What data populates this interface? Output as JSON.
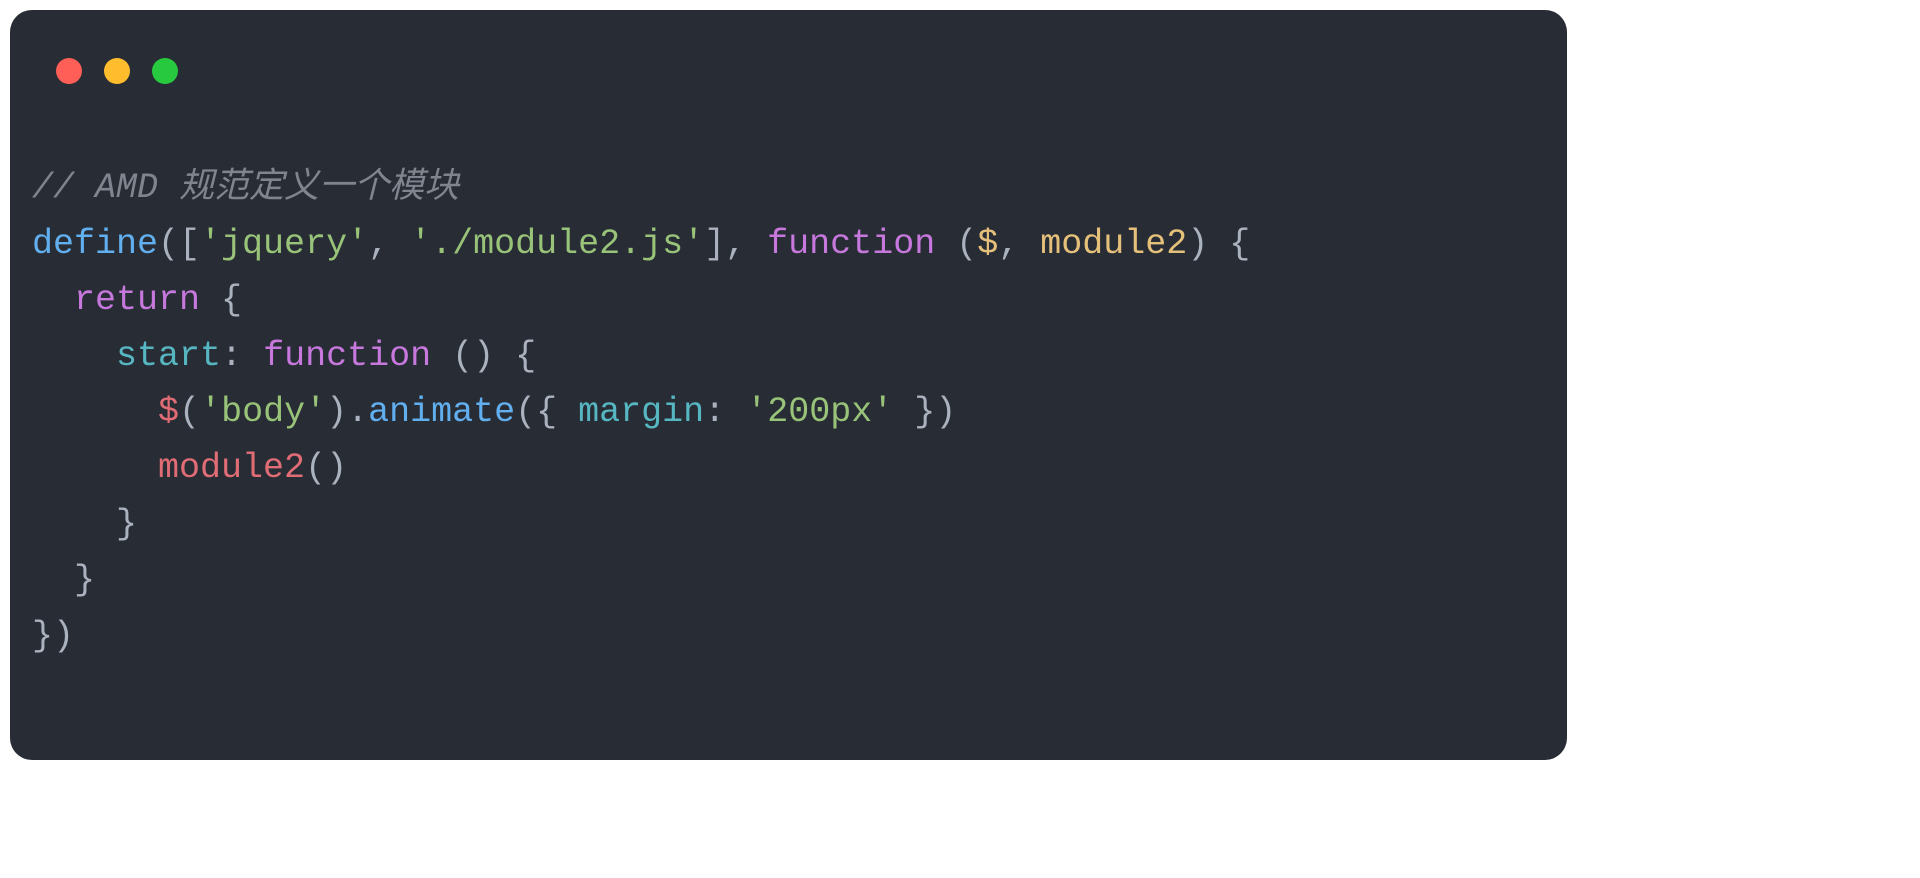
{
  "traffic": {
    "red": "#ff5f56",
    "yellow": "#ffbd2e",
    "green": "#27c93f"
  },
  "code": {
    "l1_comment": "// AMD 规范定义一个模块",
    "l2_define": "define",
    "l2_ob": "([",
    "l2_s1": "'jquery'",
    "l2_comma1": ", ",
    "l2_s2": "'./module2.js'",
    "l2_cb": "], ",
    "l2_fn": "function",
    "l2_sp": " ",
    "l2_op": "(",
    "l2_p1": "$",
    "l2_comma2": ", ",
    "l2_p2": "module2",
    "l2_cp": ") {",
    "l3_return": "return",
    "l3_brace": " {",
    "l4_key": "start",
    "l4_colon": ": ",
    "l4_fn": "function",
    "l4_rest": " () {",
    "l5_dollar": "$",
    "l5_op": "(",
    "l5_body": "'body'",
    "l5_cp": ").",
    "l5_animate": "animate",
    "l5_ob": "({ ",
    "l5_margin": "margin",
    "l5_colon": ": ",
    "l5_val": "'200px'",
    "l5_cb": " })",
    "l6_mod2": "module2",
    "l6_call": "()",
    "l7": "}",
    "l8": "}",
    "l9": "})",
    "ind1": "  ",
    "ind2": "    ",
    "ind3": "      "
  }
}
